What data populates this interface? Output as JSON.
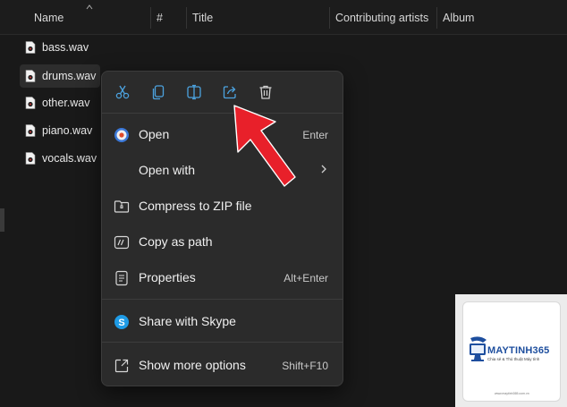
{
  "columns": {
    "name": "Name",
    "number": "#",
    "title": "Title",
    "artists": "Contributing artists",
    "album": "Album"
  },
  "files": [
    {
      "name": "bass.wav",
      "selected": false
    },
    {
      "name": "drums.wav",
      "selected": true
    },
    {
      "name": "other.wav",
      "selected": false
    },
    {
      "name": "piano.wav",
      "selected": false
    },
    {
      "name": "vocals.wav",
      "selected": false
    }
  ],
  "context_menu": {
    "quick_actions": [
      {
        "name": "cut",
        "icon": "scissors-icon"
      },
      {
        "name": "copy",
        "icon": "copy-icon"
      },
      {
        "name": "rename",
        "icon": "rename-icon"
      },
      {
        "name": "share",
        "icon": "share-icon"
      },
      {
        "name": "delete",
        "icon": "trash-icon"
      }
    ],
    "open": {
      "label": "Open",
      "shortcut": "Enter"
    },
    "open_with": {
      "label": "Open with"
    },
    "compress": {
      "label": "Compress to ZIP file"
    },
    "copy_path": {
      "label": "Copy as path"
    },
    "properties": {
      "label": "Properties",
      "shortcut": "Alt+Enter"
    },
    "share_skype": {
      "label": "Share with Skype"
    },
    "show_more": {
      "label": "Show more options",
      "shortcut": "Shift+F10"
    }
  },
  "watermark": {
    "brand": "MAYTINH365",
    "tagline": "Chia sẻ & Thủ thuật Máy tính",
    "url": "www.maytinh365.com.vn"
  },
  "colors": {
    "accent": "#4ca3e0",
    "arrow": "#e8202a",
    "menu_bg": "#2b2b2b",
    "window_bg": "#191919"
  }
}
